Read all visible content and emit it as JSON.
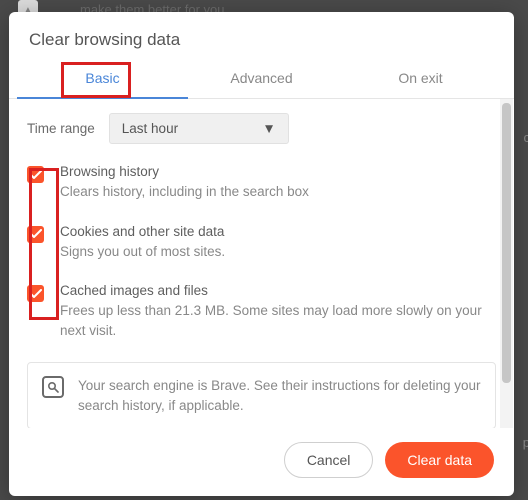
{
  "background": {
    "text": "make them better for you."
  },
  "dialog": {
    "title": "Clear browsing data"
  },
  "tabs": {
    "basic": "Basic",
    "advanced": "Advanced",
    "onexit": "On exit"
  },
  "timerange": {
    "label": "Time range",
    "value": "Last hour"
  },
  "options": {
    "history": {
      "title": "Browsing history",
      "desc": "Clears history, including in the search box"
    },
    "cookies": {
      "title": "Cookies and other site data",
      "desc": "Signs you out of most sites."
    },
    "cache": {
      "title": "Cached images and files",
      "desc": "Frees up less than 21.3 MB. Some sites may load more slowly on your next visit."
    }
  },
  "info": {
    "text": "Your search engine is Brave. See their instructions for deleting your search history, if applicable."
  },
  "footer": {
    "cancel": "Cancel",
    "confirm": "Clear data"
  },
  "sideletters": {
    "c": "c",
    "p": "p"
  }
}
